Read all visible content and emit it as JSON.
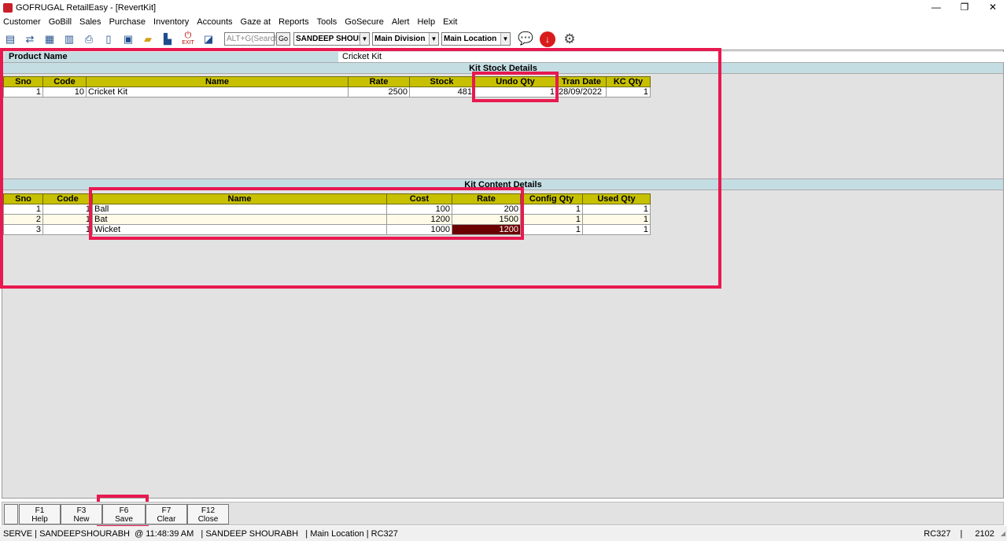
{
  "window": {
    "title": "GOFRUGAL RetailEasy - [RevertKit]",
    "minimize": "—",
    "restore": "❐",
    "close": "✕"
  },
  "menu": [
    "Customer",
    "GoBill",
    "Sales",
    "Purchase",
    "Inventory",
    "Accounts",
    "Gaze at",
    "Reports",
    "Tools",
    "GoSecure",
    "Alert",
    "Help",
    "Exit"
  ],
  "toolbar": {
    "exit_label": "EXIT",
    "search_placeholder": "ALT+G(Search)",
    "go_label": "Go",
    "user_select": "SANDEEP SHOURA",
    "division_select": "Main Division",
    "location_select": "Main Location"
  },
  "product": {
    "label": "Product Name",
    "value": "Cricket Kit"
  },
  "kit_stock": {
    "header": "Kit Stock Details",
    "columns": [
      "Sno",
      "Code",
      "Name",
      "Rate",
      "Stock",
      "Undo Qty",
      "Tran Date",
      "KC Qty"
    ],
    "rows": [
      [
        "1",
        "10",
        "Cricket Kit",
        "2500",
        "481",
        "1",
        "28/09/2022",
        "1"
      ]
    ]
  },
  "kit_content": {
    "header": "Kit Content Details",
    "columns": [
      "Sno",
      "Code",
      "Name",
      "Cost",
      "Rate",
      "Config Qty",
      "Used Qty"
    ],
    "rows": [
      [
        "1",
        "1",
        "Ball",
        "100",
        "200",
        "1",
        "1"
      ],
      [
        "2",
        "1",
        "Bat",
        "1200",
        "1500",
        "1",
        "1"
      ],
      [
        "3",
        "1",
        "Wicket",
        "1000",
        "1200",
        "1",
        "1"
      ]
    ]
  },
  "fkeys": [
    {
      "key": "F1",
      "label": "Help"
    },
    {
      "key": "F3",
      "label": "New"
    },
    {
      "key": "F6",
      "label": "Save"
    },
    {
      "key": "F7",
      "label": "Clear"
    },
    {
      "key": "F12",
      "label": "Close"
    }
  ],
  "status": {
    "left": "SERVE | SANDEEPSHOURABH  @ 11:48:39 AM   | SANDEEP SHOURABH   | Main Location | RC327",
    "code": "RC327",
    "sep": "|",
    "number": "2102"
  },
  "colors": {
    "grid_header": "#c7c000",
    "section_header": "#c4dde3",
    "annotation": "#e8194f",
    "selected_cell": "#6b0000"
  }
}
